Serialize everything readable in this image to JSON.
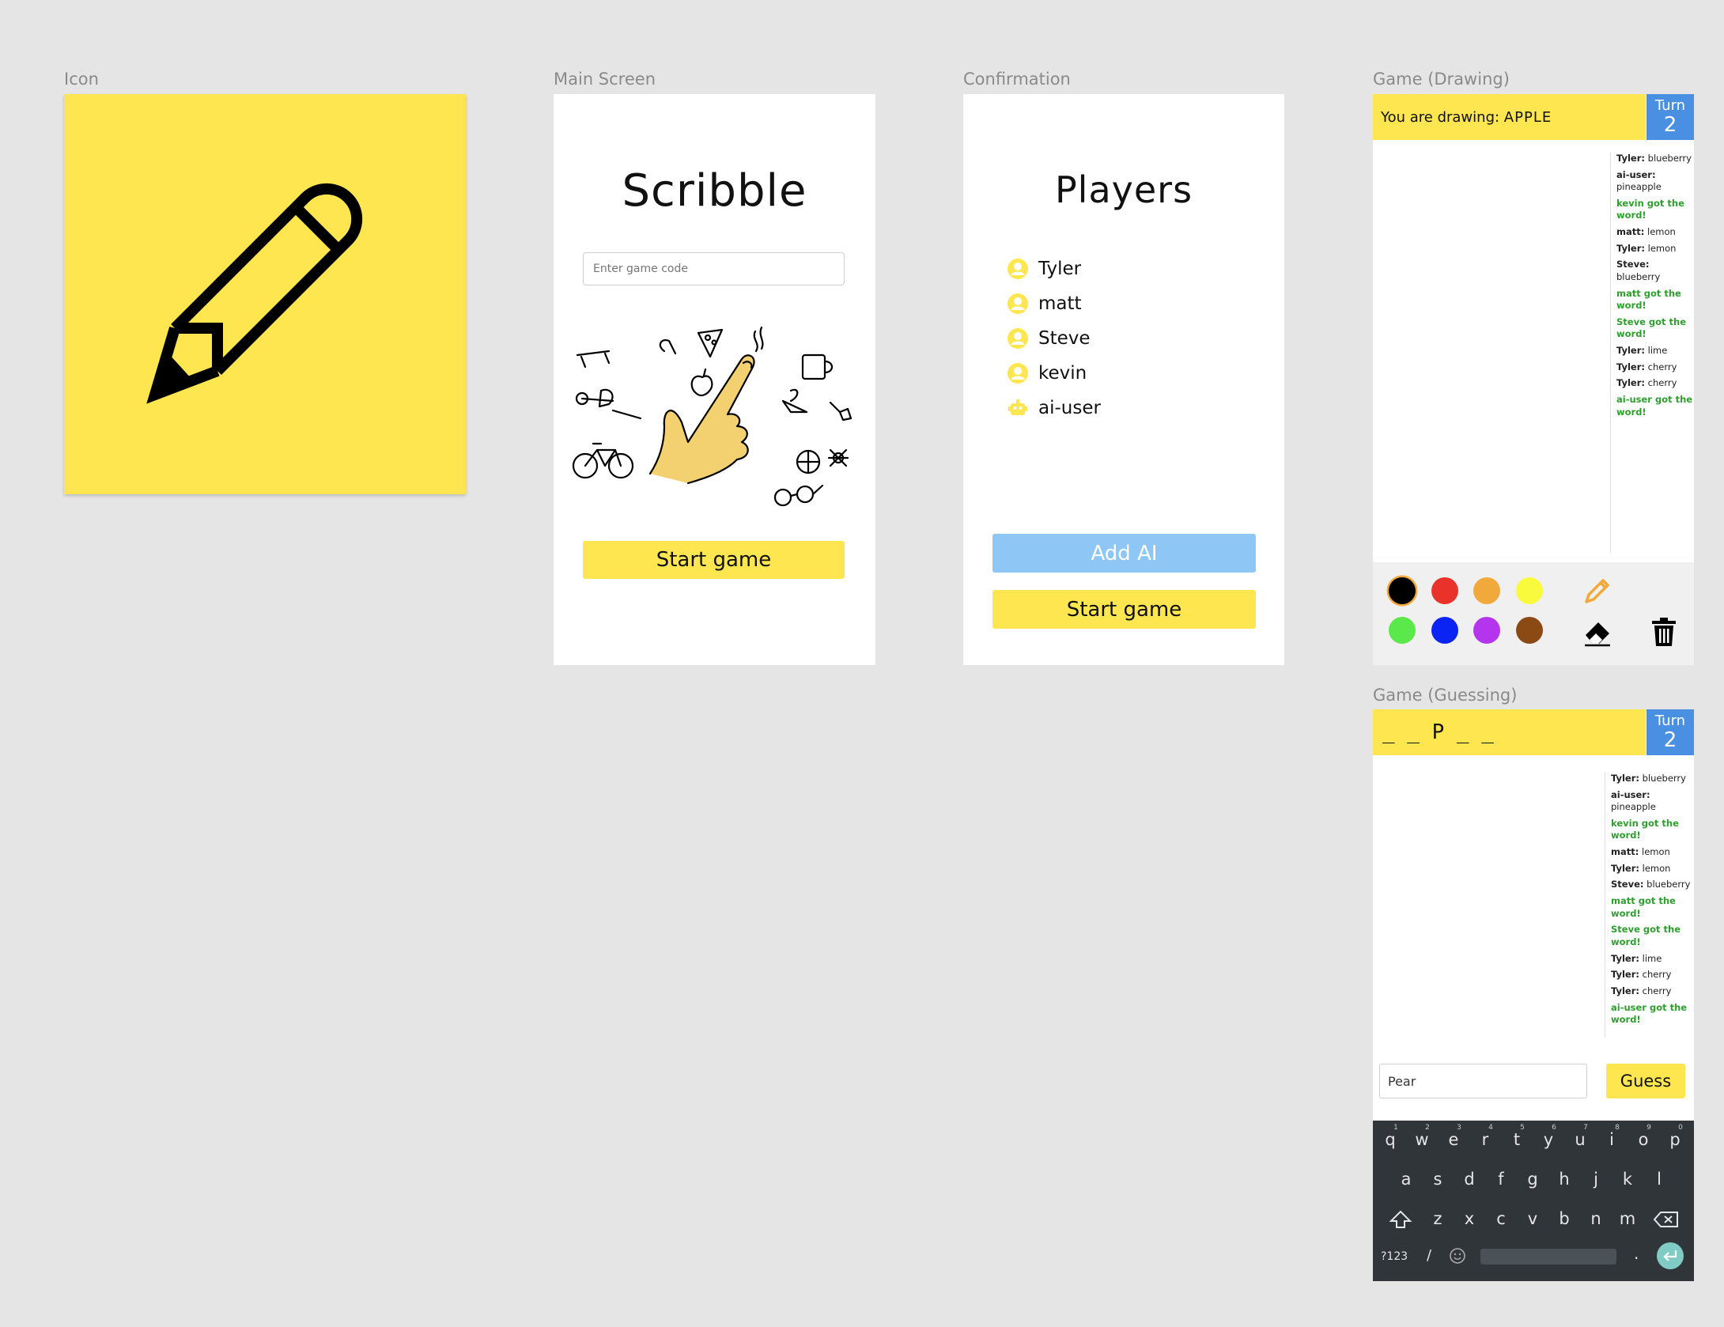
{
  "frames": {
    "icon": "Icon",
    "main": "Main Screen",
    "confirm": "Confirmation",
    "drawing": "Game (Drawing)",
    "guessing": "Game (Guessing)"
  },
  "main": {
    "title": "Scribble",
    "game_code_placeholder": "Enter game code",
    "start_label": "Start game"
  },
  "confirm": {
    "title": "Players",
    "players": [
      {
        "name": "Tyler",
        "icon": "user-icon"
      },
      {
        "name": "matt",
        "icon": "user-icon"
      },
      {
        "name": "Steve",
        "icon": "user-icon"
      },
      {
        "name": "kevin",
        "icon": "user-icon"
      },
      {
        "name": "ai-user",
        "icon": "robot-icon"
      }
    ],
    "add_ai_label": "Add AI",
    "start_label": "Start game"
  },
  "drawing": {
    "prompt_prefix": "You are drawing:",
    "word": "APPLE",
    "turn_label": "Turn",
    "turn_number": "2",
    "colors": [
      "#000000",
      "#e8322a",
      "#f2a93b",
      "#fafa3c",
      "#5be84a",
      "#0b24f4",
      "#b535ee",
      "#8b4a14"
    ],
    "tools": [
      "pencil-icon",
      "eraser-icon",
      "trash-icon"
    ]
  },
  "guessing": {
    "masked_word": "_ _ P _ _",
    "turn_label": "Turn",
    "turn_number": "2",
    "guess_value": "Pear",
    "guess_label": "Guess"
  },
  "chat": [
    {
      "user": "Tyler:",
      "text": "blueberry"
    },
    {
      "user": "ai-user:",
      "text": "pineapple"
    },
    {
      "system": "kevin got the word!"
    },
    {
      "user": "matt:",
      "text": "lemon"
    },
    {
      "user": "Tyler:",
      "text": "lemon"
    },
    {
      "user": "Steve:",
      "text": "blueberry"
    },
    {
      "system": "matt got the word!"
    },
    {
      "system": "Steve got the word!"
    },
    {
      "user": "Tyler:",
      "text": "lime"
    },
    {
      "user": "Tyler:",
      "text": "cherry"
    },
    {
      "user": "Tyler:",
      "text": "cherry"
    },
    {
      "system": "ai-user got the word!"
    }
  ],
  "keyboard": {
    "row1": [
      [
        "q",
        "1"
      ],
      [
        "w",
        "2"
      ],
      [
        "e",
        "3"
      ],
      [
        "r",
        "4"
      ],
      [
        "t",
        "5"
      ],
      [
        "y",
        "6"
      ],
      [
        "u",
        "7"
      ],
      [
        "i",
        "8"
      ],
      [
        "o",
        "9"
      ],
      [
        "p",
        "0"
      ]
    ],
    "row2": [
      "a",
      "s",
      "d",
      "f",
      "g",
      "h",
      "j",
      "k",
      "l"
    ],
    "row3": [
      "z",
      "x",
      "c",
      "v",
      "b",
      "n",
      "m"
    ],
    "sym_label": "?123",
    "slash": "/"
  },
  "colors": {
    "yellow": "#fde64f",
    "blue_turn": "#4a90e2",
    "add_ai": "#8ec6f5",
    "system_msg": "#2e9e2e"
  }
}
